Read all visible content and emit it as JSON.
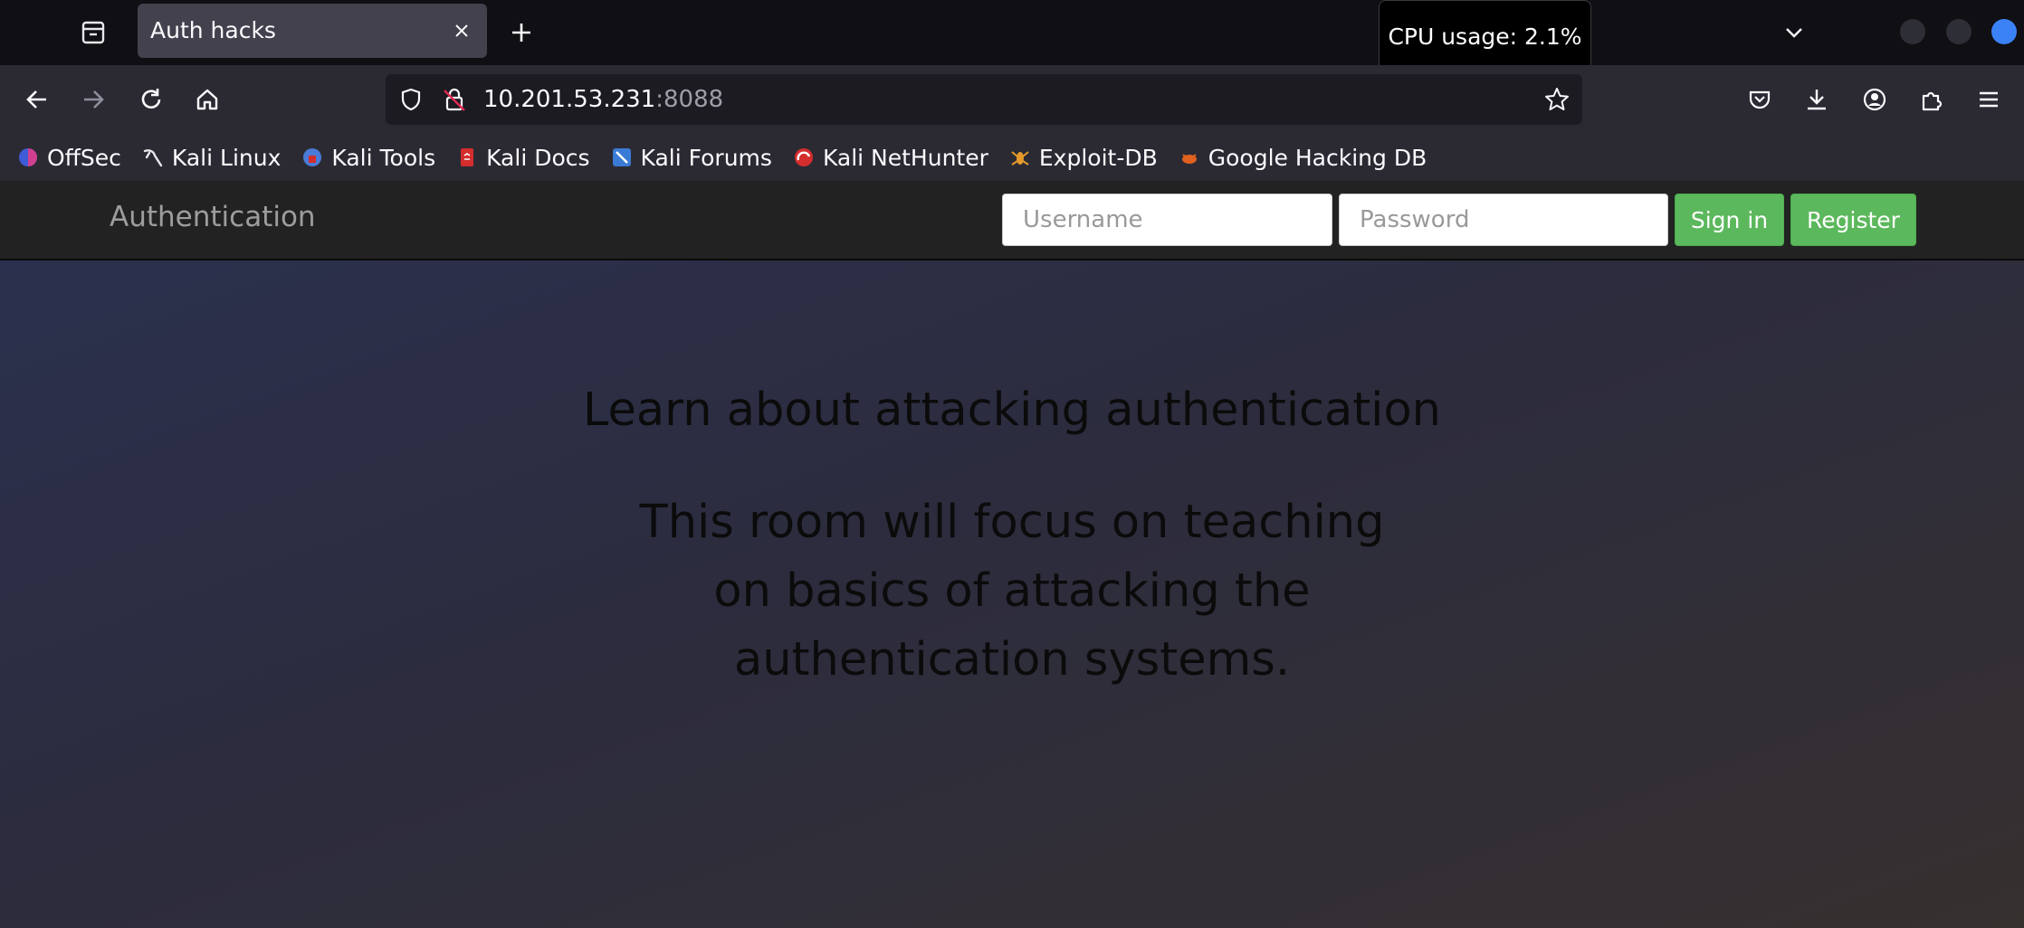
{
  "browser": {
    "tab": {
      "title": "Auth hacks"
    },
    "cpu_tooltip": "CPU usage: 2.1%",
    "url": {
      "host": "10.201.53.231",
      "port": ":8088"
    },
    "bookmarks": [
      {
        "label": "OffSec",
        "icon": "offsec-icon",
        "color": "#3f5bd6"
      },
      {
        "label": "Kali Linux",
        "icon": "kali-dragon-icon",
        "color": "#e8e8ec"
      },
      {
        "label": "Kali Tools",
        "icon": "kali-tools-icon",
        "color": "#4b7bd8"
      },
      {
        "label": "Kali Docs",
        "icon": "kali-docs-icon",
        "color": "#d42d2d"
      },
      {
        "label": "Kali Forums",
        "icon": "kali-forums-icon",
        "color": "#3a7bd5"
      },
      {
        "label": "Kali NetHunter",
        "icon": "nethunter-icon",
        "color": "#d42d2d"
      },
      {
        "label": "Exploit-DB",
        "icon": "exploit-db-icon",
        "color": "#e49a2a"
      },
      {
        "label": "Google Hacking DB",
        "icon": "ghdb-icon",
        "color": "#e0611f"
      }
    ]
  },
  "site": {
    "brand": "Authentication",
    "username_placeholder": "Username",
    "password_placeholder": "Password",
    "signin_label": "Sign in",
    "register_label": "Register",
    "hero_title": "Learn about attacking authentication",
    "hero_text": "This room will focus on teaching on basics of attacking the authentication systems.",
    "accent_color": "#5cb85c"
  }
}
